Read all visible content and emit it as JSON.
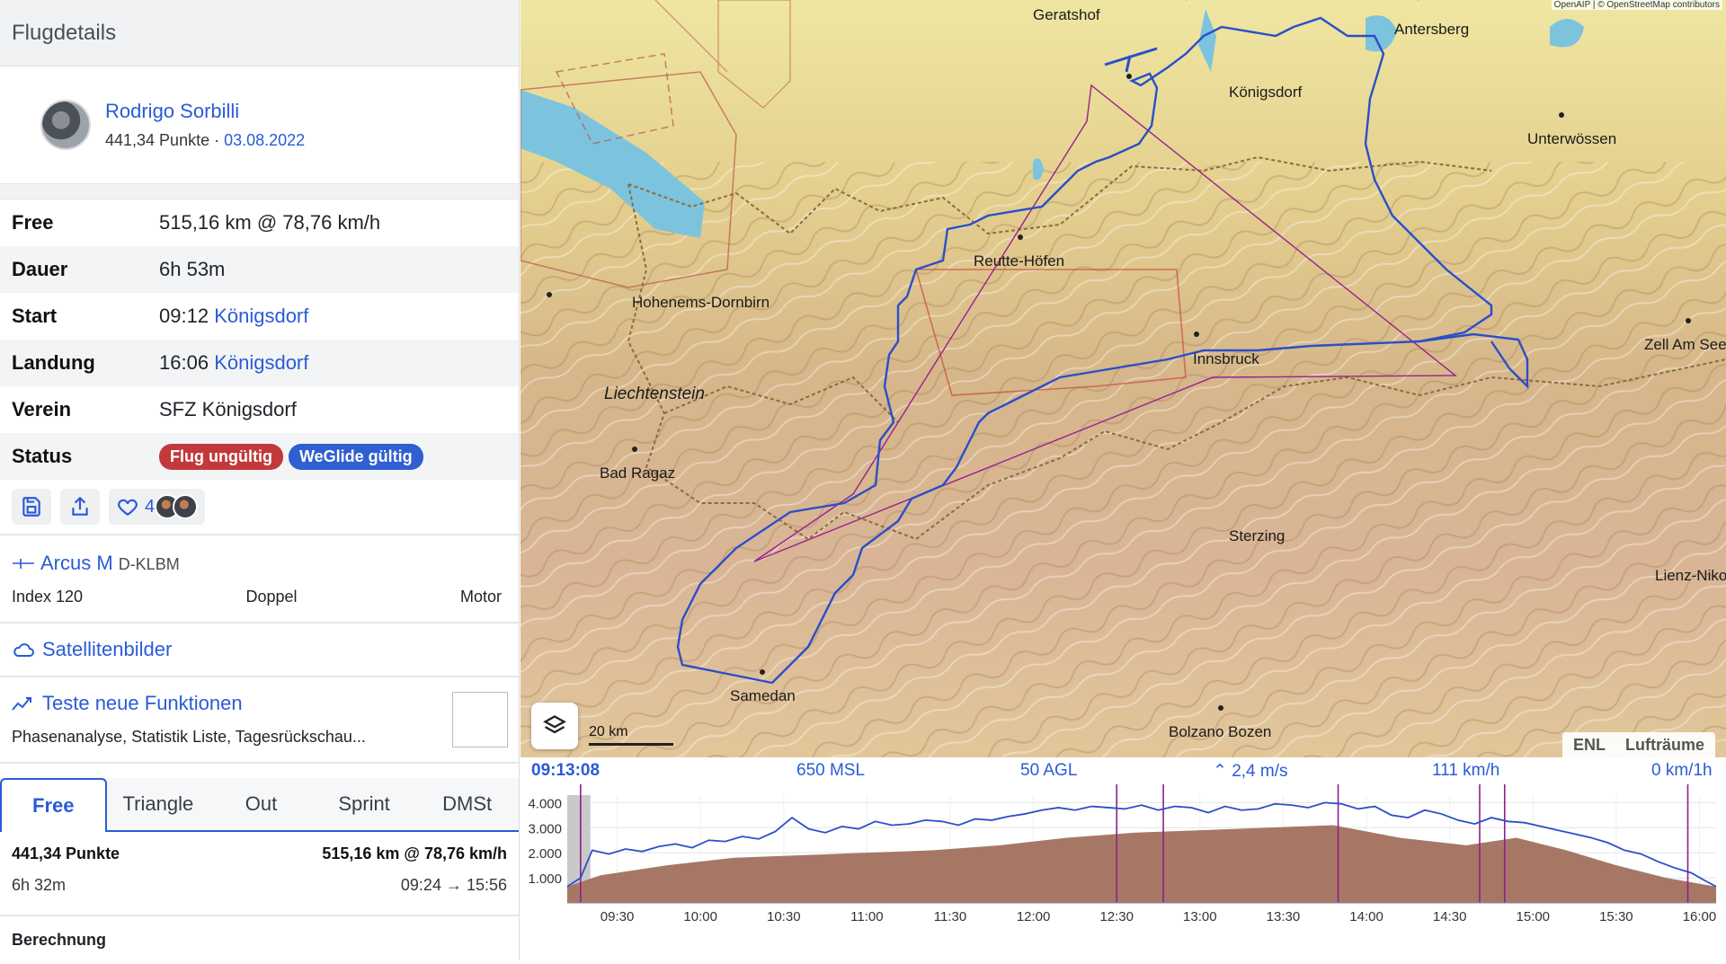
{
  "panel": {
    "title": "Flugdetails",
    "pilot": {
      "name": "Rodrigo Sorbilli",
      "points": "441,34 Punkte",
      "sep": " · ",
      "date": "03.08.2022"
    },
    "rows": [
      {
        "key": "Free",
        "value": "515,16 km @ 78,76 km/h"
      },
      {
        "key": "Dauer",
        "value": "6h 53m"
      },
      {
        "key": "Start",
        "time": "09:12",
        "link": "Königsdorf"
      },
      {
        "key": "Landung",
        "time": "16:06",
        "link": "Königsdorf"
      },
      {
        "key": "Verein",
        "link": "SFZ Königsdorf"
      },
      {
        "key": "Status"
      }
    ],
    "status": {
      "invalid": "Flug ungültig",
      "valid": "WeGlide gültig",
      "invalid_color": "#c2393b",
      "valid_color": "#2f5fd0"
    },
    "actions": {
      "likes": "4",
      "icons": [
        "save-icon",
        "share-icon",
        "heart-icon"
      ]
    },
    "glider": {
      "model": "Arcus M",
      "registration": "D-KLBM",
      "index": "Index 120",
      "seats": "Doppel",
      "engine": "Motor"
    },
    "satellite": "Satellitenbilder",
    "new_features": {
      "title": "Teste neue Funktionen",
      "subtitle": "Phasenanalyse, Statistik Liste, Tagesrückschau..."
    },
    "tabs": [
      "Free",
      "Triangle",
      "Out",
      "Sprint",
      "DMSt"
    ],
    "active_tab": "Free",
    "score": {
      "points": "441,34 Punkte",
      "distance": "515,16 km @ 78,76 km/h",
      "duration": "6h 32m",
      "range": "09:24 → 15:56"
    },
    "calc_label": "Berechnung"
  },
  "map": {
    "attribution": "OpenAIP | © OpenStreetMap contributors",
    "scale": "20 km",
    "toggles": [
      "ENL",
      "Lufträume"
    ],
    "places": [
      "Geratshof",
      "Antersberg",
      "Königsdorf",
      "Unterwössen",
      "Reutte-Höfen",
      "Hohenems-Dornbirn",
      "Innsbruck",
      "Zell Am See",
      "Liechtenstein",
      "Bad Ragaz",
      "Sterzing",
      "Lienz-Niko",
      "Samedan",
      "Bolzano Bozen"
    ],
    "track_color": "#2a4fc9",
    "task_color": "#9b1f8f"
  },
  "barogram": {
    "readout": {
      "time": "09:13:08",
      "msl": "650 MSL",
      "agl": "50 AGL",
      "vario": "2,4 m/s",
      "speed": "111 km/h",
      "wind": "0 km/1h"
    },
    "chart_data": {
      "type": "area",
      "x_label": "",
      "y_label": "",
      "xticks": [
        "09:30",
        "10:00",
        "10:30",
        "11:00",
        "11:30",
        "12:00",
        "12:30",
        "13:00",
        "13:30",
        "14:00",
        "14:30",
        "15:00",
        "15:30",
        "16:00"
      ],
      "yticks": [
        "1.000",
        "2.000",
        "3.000",
        "4.000"
      ],
      "ylim": [
        0,
        4300
      ],
      "xlim_hours": [
        9.2,
        16.1
      ],
      "series": [
        {
          "kind": "altitude-msl",
          "x": [
            9.2,
            9.28,
            9.35,
            9.45,
            9.55,
            9.65,
            9.75,
            9.85,
            9.95,
            10.05,
            10.15,
            10.25,
            10.35,
            10.45,
            10.55,
            10.65,
            10.75,
            10.85,
            10.95,
            11.05,
            11.15,
            11.25,
            11.35,
            11.45,
            11.55,
            11.65,
            11.75,
            11.85,
            11.95,
            12.05,
            12.15,
            12.25,
            12.35,
            12.45,
            12.55,
            12.65,
            12.75,
            12.85,
            12.95,
            13.05,
            13.15,
            13.25,
            13.35,
            13.45,
            13.55,
            13.65,
            13.75,
            13.85,
            13.95,
            14.05,
            14.15,
            14.25,
            14.35,
            14.45,
            14.55,
            14.65,
            14.75,
            14.85,
            14.95,
            15.05,
            15.15,
            15.25,
            15.35,
            15.45,
            15.55,
            15.65,
            15.75,
            15.85,
            15.95,
            16.03,
            16.1
          ],
          "y": [
            650,
            1000,
            2100,
            1950,
            2150,
            2050,
            2250,
            2350,
            2200,
            2500,
            2450,
            2650,
            2550,
            2850,
            3400,
            2950,
            2800,
            3050,
            2950,
            3250,
            3100,
            3150,
            3300,
            3250,
            3100,
            3350,
            3300,
            3450,
            3550,
            3700,
            3800,
            3700,
            3850,
            3800,
            3750,
            3900,
            3700,
            3850,
            3800,
            3600,
            3850,
            3700,
            3750,
            3950,
            3900,
            3800,
            4000,
            3950,
            3750,
            3850,
            3500,
            3400,
            3700,
            3550,
            3300,
            3150,
            3400,
            3250,
            3200,
            3050,
            2900,
            2750,
            2600,
            2400,
            2100,
            1950,
            1650,
            1400,
            1200,
            900,
            650
          ]
        },
        {
          "kind": "terrain",
          "x": [
            9.2,
            9.4,
            9.8,
            10.2,
            10.6,
            11.0,
            11.4,
            11.8,
            12.2,
            12.6,
            13.0,
            13.4,
            13.8,
            14.2,
            14.6,
            14.9,
            15.2,
            15.5,
            15.8,
            16.1
          ],
          "y": [
            650,
            1100,
            1500,
            1800,
            1900,
            2000,
            2100,
            2300,
            2600,
            2800,
            2900,
            3000,
            3100,
            2600,
            2300,
            2600,
            2100,
            1500,
            1000,
            650
          ]
        }
      ],
      "markers_hours": [
        9.28,
        12.5,
        12.78,
        13.83,
        14.68,
        14.83,
        15.93
      ]
    }
  }
}
